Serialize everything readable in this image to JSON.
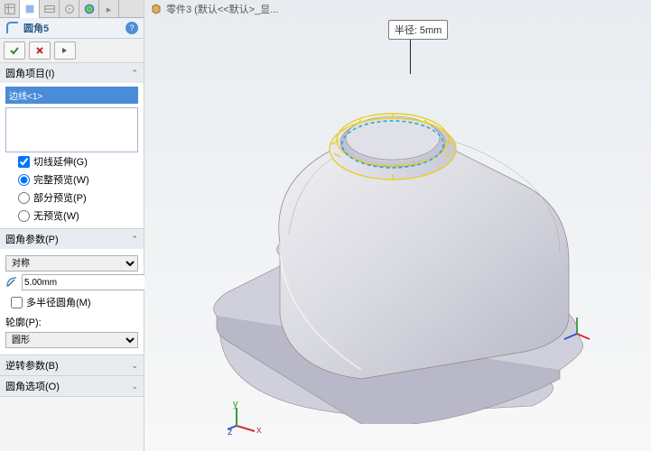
{
  "tabs": {
    "count": 6
  },
  "feature": {
    "title": "圆角5"
  },
  "sections": {
    "items": {
      "label": "圆角项目(I)",
      "selection": "边线<1>"
    },
    "tangent": {
      "label": "切线延伸(G)"
    },
    "preview_full": {
      "label": "完整预览(W)"
    },
    "preview_partial": {
      "label": "部分预览(P)"
    },
    "preview_none": {
      "label": "无预览(W)"
    },
    "params": {
      "label": "圆角参数(P)",
      "symmetry": "对称",
      "radius": "5.00mm",
      "multiradius": "多半径圆角(M)"
    },
    "profile": {
      "label": "轮廓(P):",
      "shape": "圆形"
    },
    "reverse": {
      "label": "逆转参数(B)"
    },
    "options": {
      "label": "圆角选项(O)"
    }
  },
  "breadcrumb": {
    "text": "零件3 (默认<<默认>_显..."
  },
  "callout": {
    "label": "半径:",
    "value": "5mm"
  }
}
